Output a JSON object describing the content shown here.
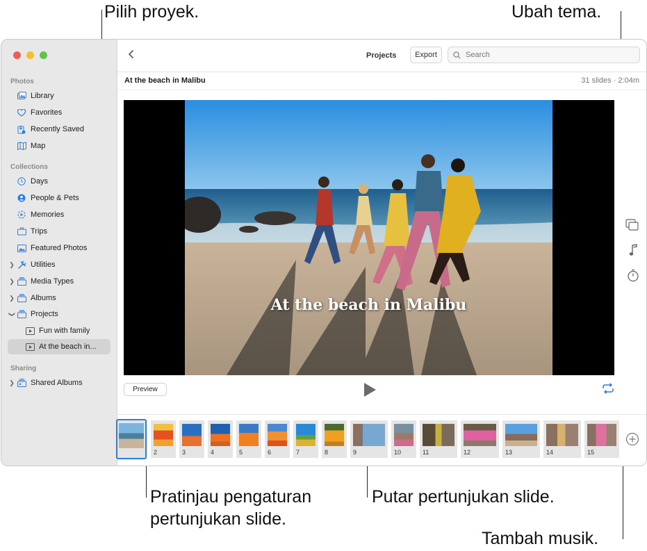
{
  "callouts": {
    "choose_project": "Pilih proyek.",
    "change_theme": "Ubah tema.",
    "preview_settings_1": "Pratinjau pengaturan",
    "preview_settings_2": "pertunjukan slide.",
    "play_slideshow": "Putar pertunjukan slide.",
    "add_music": "Tambah musik."
  },
  "window": {
    "traffic_lights": [
      "#ec5f57",
      "#f5be33",
      "#5ec447"
    ]
  },
  "sidebar": {
    "sections": {
      "photos": "Photos",
      "collections": "Collections",
      "sharing": "Sharing"
    },
    "photos_items": [
      {
        "label": "Library",
        "icon": "library-icon"
      },
      {
        "label": "Favorites",
        "icon": "heart-icon"
      },
      {
        "label": "Recently Saved",
        "icon": "recently-saved-icon"
      },
      {
        "label": "Map",
        "icon": "map-icon"
      }
    ],
    "collection_items": [
      {
        "label": "Days",
        "icon": "clock-icon"
      },
      {
        "label": "People & Pets",
        "icon": "person-icon"
      },
      {
        "label": "Memories",
        "icon": "memories-icon"
      },
      {
        "label": "Trips",
        "icon": "suitcase-icon"
      },
      {
        "label": "Featured Photos",
        "icon": "photo-icon"
      },
      {
        "label": "Utilities",
        "icon": "tools-icon"
      },
      {
        "label": "Media Types",
        "icon": "stack-icon"
      },
      {
        "label": "Albums",
        "icon": "stack-icon"
      },
      {
        "label": "Projects",
        "icon": "stack-icon"
      }
    ],
    "projects": [
      {
        "label": "Fun with family",
        "icon": "slideshow-icon"
      },
      {
        "label": "At the beach in...",
        "icon": "slideshow-icon"
      }
    ],
    "sharing_items": [
      {
        "label": "Shared Albums",
        "icon": "shared-album-icon"
      }
    ]
  },
  "toolbar": {
    "title": "Projects",
    "export_label": "Export",
    "search_placeholder": "Search"
  },
  "project": {
    "title": "At the beach in Malibu",
    "info": "31 slides · 2:04m"
  },
  "slide": {
    "caption": "At the beach in Malibu"
  },
  "controls": {
    "preview_label": "Preview"
  },
  "accent_color": "#2a7de1",
  "filmstrip": {
    "numbers": [
      "",
      "2",
      "3",
      "4",
      "5",
      "6",
      "7",
      "8",
      "9",
      "10",
      "11",
      "12",
      "13",
      "14",
      "15"
    ]
  }
}
